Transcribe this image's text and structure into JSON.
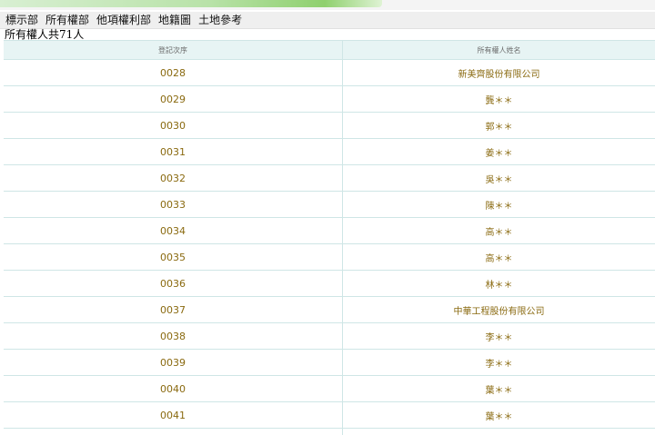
{
  "tabs": [
    "標示部",
    "所有權部",
    "他項權利部",
    "地籍圖",
    "土地參考"
  ],
  "summary": "所有權人共71人",
  "table": {
    "headers": [
      "登記次序",
      "所有權人姓名"
    ],
    "rows": [
      [
        "0028",
        "新美齊股份有限公司"
      ],
      [
        "0029",
        "龔＊＊"
      ],
      [
        "0030",
        "郭＊＊"
      ],
      [
        "0031",
        "姜＊＊"
      ],
      [
        "0032",
        "吳＊＊"
      ],
      [
        "0033",
        "陳＊＊"
      ],
      [
        "0034",
        "高＊＊"
      ],
      [
        "0035",
        "高＊＊"
      ],
      [
        "0036",
        "林＊＊"
      ],
      [
        "0037",
        "中華工程股份有限公司"
      ],
      [
        "0038",
        "李＊＊"
      ],
      [
        "0039",
        "李＊＊"
      ],
      [
        "0040",
        "葉＊＊"
      ],
      [
        "0041",
        "葉＊＊"
      ],
      [
        "",
        ""
      ]
    ]
  },
  "colors": {
    "header_bg": "#e7f4f4",
    "border": "#cfe6e6",
    "cell_text": "#8a6a10"
  }
}
